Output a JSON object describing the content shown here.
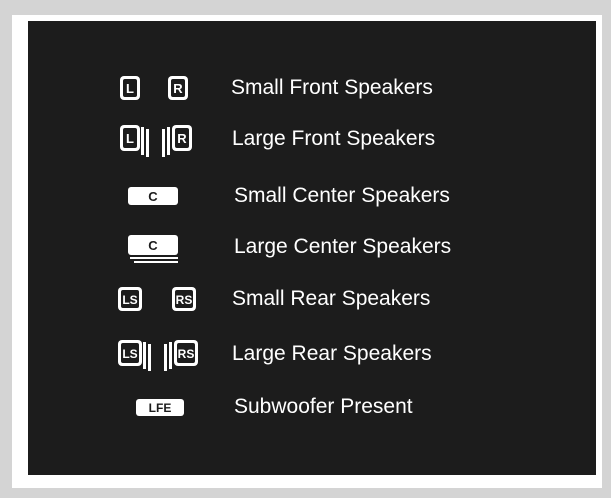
{
  "colors": {
    "panel": "#1c1c1c",
    "frame": "#ffffff",
    "page": "#d4d4d4",
    "text": "#ffffff"
  },
  "legend": [
    {
      "icon": "small-front-speakers-icon",
      "letters_left": "L",
      "letters_right": "R",
      "label": "Small Front Speakers"
    },
    {
      "icon": "large-front-speakers-icon",
      "letters_left": "L",
      "letters_right": "R",
      "label": "Large Front Speakers"
    },
    {
      "icon": "small-center-speaker-icon",
      "letters": "C",
      "label": "Small Center Speakers"
    },
    {
      "icon": "large-center-speaker-icon",
      "letters": "C",
      "label": "Large Center Speakers"
    },
    {
      "icon": "small-rear-speakers-icon",
      "letters_left": "LS",
      "letters_right": "RS",
      "label": "Small Rear Speakers"
    },
    {
      "icon": "large-rear-speakers-icon",
      "letters_left": "LS",
      "letters_right": "RS",
      "label": "Large Rear Speakers"
    },
    {
      "icon": "subwoofer-icon",
      "letters": "LFE",
      "label": "Subwoofer Present"
    }
  ]
}
